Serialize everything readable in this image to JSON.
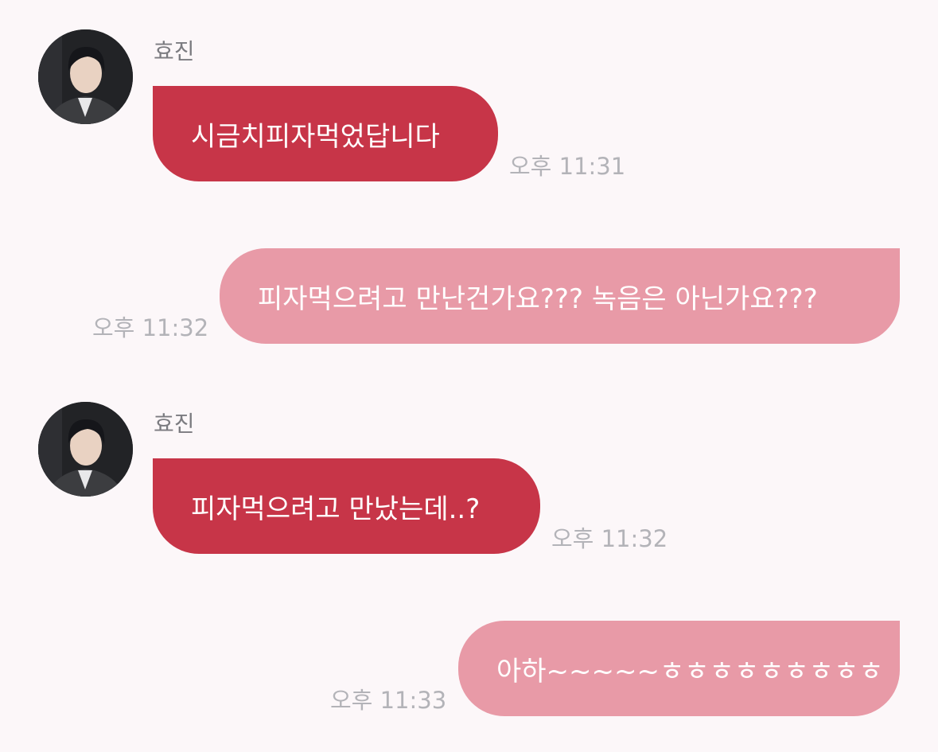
{
  "messages": [
    {
      "direction": "incoming",
      "sender": "효진",
      "avatar_icon": "profile-photo",
      "text": "시금치피자먹었답니다",
      "time": "오후 11:31"
    },
    {
      "direction": "outgoing",
      "text": "피자먹으려고 만난건가요??? 녹음은 아닌가요???",
      "time": "오후 11:32"
    },
    {
      "direction": "incoming",
      "sender": "효진",
      "avatar_icon": "profile-photo",
      "text": "피자먹으려고 만났는데..?",
      "time": "오후 11:32"
    },
    {
      "direction": "outgoing",
      "text": "아하~~~~~ㅎㅎㅎㅎㅎㅎㅎㅎㅎ",
      "time": "오후 11:33"
    }
  ],
  "colors": {
    "background": "#fcf7f9",
    "incoming_bubble": "#c73548",
    "outgoing_bubble": "#e89aa7",
    "timestamp": "#b3b3b8",
    "sender_name": "#7b7b80"
  }
}
